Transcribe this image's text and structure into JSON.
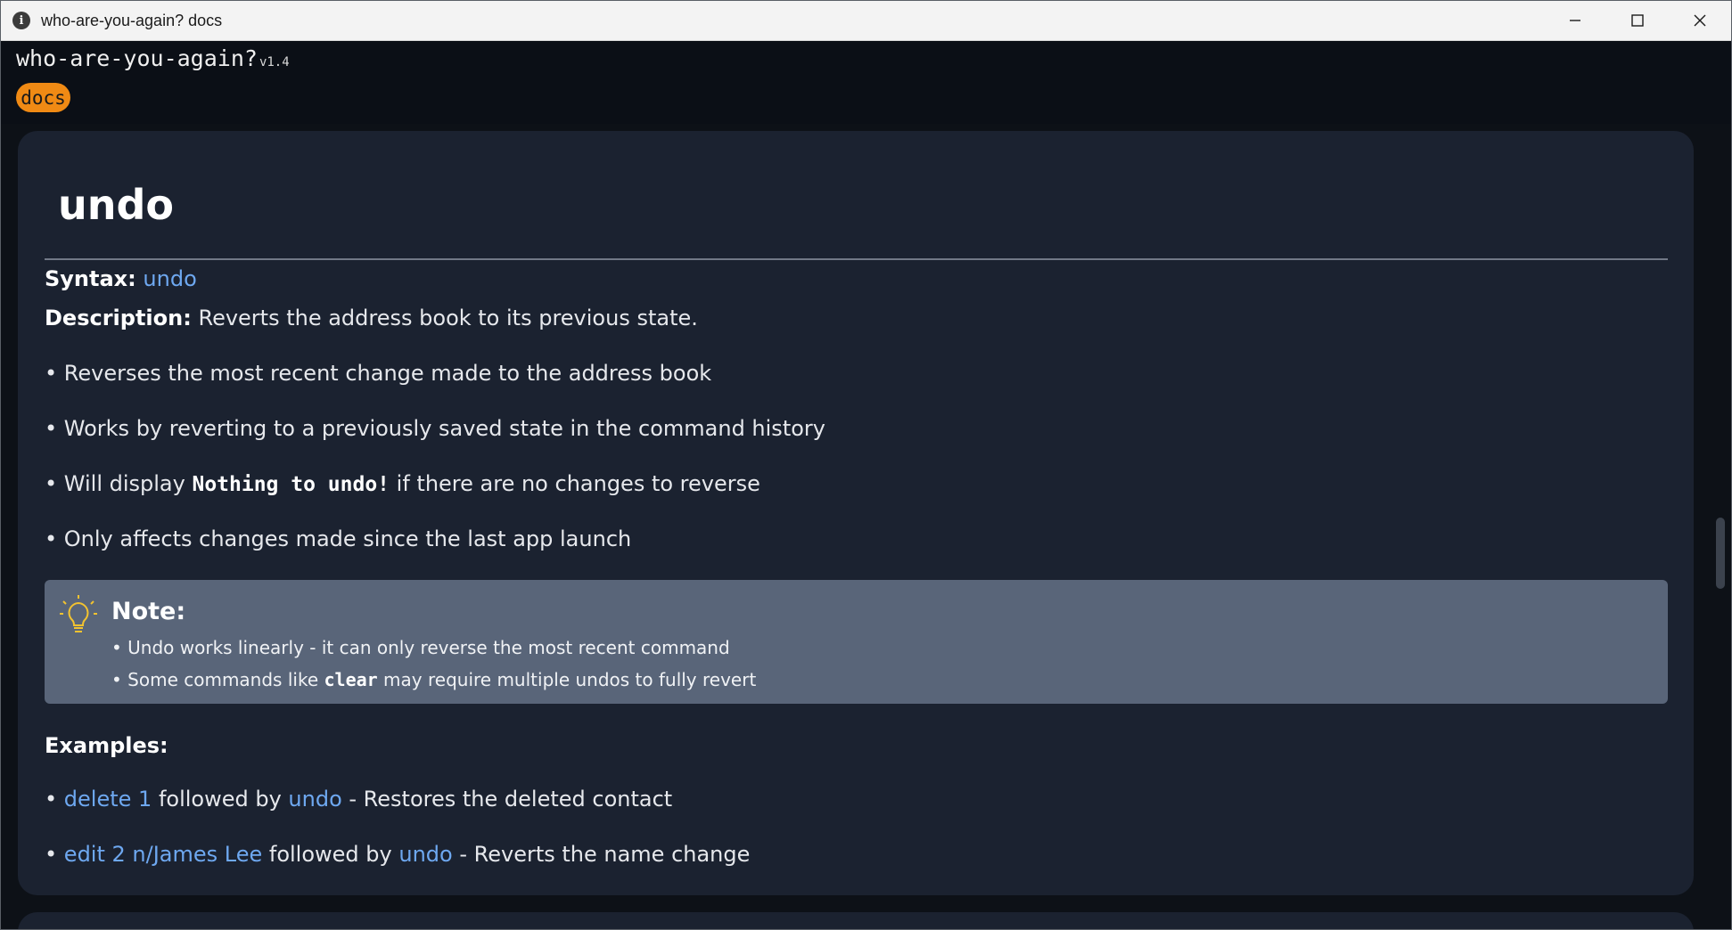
{
  "window": {
    "title": "who-are-you-again? docs",
    "icon": "info-icon"
  },
  "app": {
    "name": "who-are-you-again?",
    "version": "v1.4",
    "tab": "docs"
  },
  "doc": {
    "title": "undo",
    "syntax_label": "Syntax:",
    "syntax_value": "undo",
    "description_label": "Description:",
    "description_text": "Reverts the address book to its previous state.",
    "bullets": [
      {
        "text": "• Reverses the most recent change made to the address book"
      },
      {
        "text": "• Works by reverting to a previously saved state in the command history"
      },
      {
        "pre": "• Will display ",
        "code": "Nothing to undo!",
        "post": " if there are no changes to reverse"
      },
      {
        "text": "• Only affects changes made since the last app launch"
      }
    ],
    "note": {
      "title": "Note:",
      "icon": "lightbulb-icon",
      "items": [
        {
          "text": "• Undo works linearly - it can only reverse the most recent command"
        },
        {
          "pre": "• Some commands like ",
          "code": "clear",
          "post": " may require multiple undos to fully revert"
        }
      ]
    },
    "examples_label": "Examples:",
    "examples": [
      {
        "bullet": "• ",
        "cmd": "delete 1",
        "mid": " followed by ",
        "cmd2": "undo",
        "desc": " - Restores the deleted contact"
      },
      {
        "bullet": "• ",
        "cmd": "edit 2 n/James Lee",
        "mid": " followed by ",
        "cmd2": "undo",
        "desc": " - Reverts the name change"
      }
    ]
  },
  "colors": {
    "accent": "#f08a14",
    "link": "#6ea8f0",
    "card": "#1b2230",
    "note_bg": "#596579"
  }
}
